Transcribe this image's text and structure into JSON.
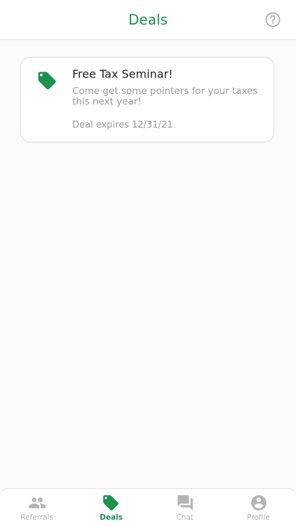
{
  "header": {
    "title": "Deals"
  },
  "deals": [
    {
      "title": "Free Tax Seminar!",
      "description": "Come get some pointers for your taxes this next year!",
      "expiry": "Deal expires 12/31/21"
    }
  ],
  "tabs": [
    {
      "label": "Referrals",
      "icon": "people-icon",
      "active": false
    },
    {
      "label": "Deals",
      "icon": "tag-icon",
      "active": true
    },
    {
      "label": "Chat",
      "icon": "chat-icon",
      "active": false
    },
    {
      "label": "Profile",
      "icon": "profile-icon",
      "active": false
    }
  ],
  "colors": {
    "accent": "#1e9150",
    "inactive": "#b4b4b4",
    "muted_text": "#9a9a9a"
  }
}
